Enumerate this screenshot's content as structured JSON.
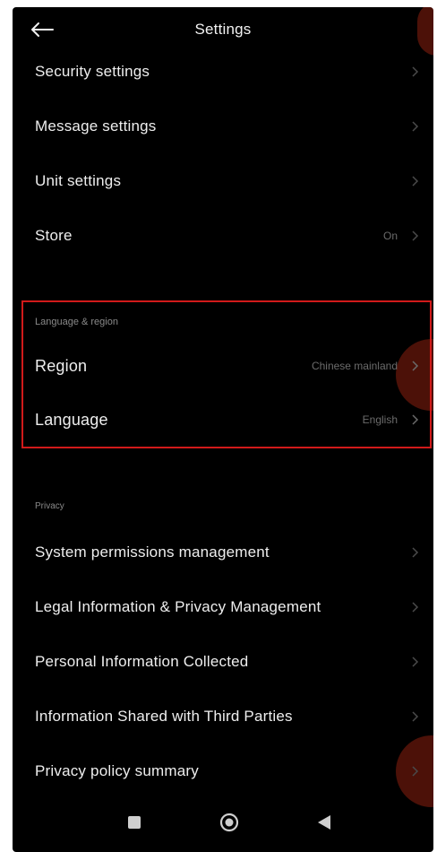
{
  "header": {
    "title": "Settings",
    "back_icon": "arrow-left-icon"
  },
  "rows_top": [
    {
      "label": "Security settings",
      "value": ""
    },
    {
      "label": "Message settings",
      "value": ""
    },
    {
      "label": "Unit settings",
      "value": ""
    },
    {
      "label": "Store",
      "value": "On"
    }
  ],
  "language_region": {
    "section_title": "Language & region",
    "region": {
      "label": "Region",
      "value": "Chinese mainland"
    },
    "language": {
      "label": "Language",
      "value": "English"
    }
  },
  "privacy": {
    "section_title": "Privacy",
    "items": [
      {
        "label": "System permissions management"
      },
      {
        "label": "Legal Information & Privacy Management"
      },
      {
        "label": "Personal Information Collected"
      },
      {
        "label": "Information Shared with Third Parties"
      },
      {
        "label": "Privacy policy summary"
      }
    ]
  },
  "nav_bar": {
    "recents_icon": "square-icon",
    "home_icon": "circle-home-icon",
    "back_icon": "triangle-back-icon"
  },
  "colors": {
    "background": "#000000",
    "text_primary": "#eeeeee",
    "text_secondary": "#6b6b6b",
    "highlight": "#d11a1a"
  }
}
